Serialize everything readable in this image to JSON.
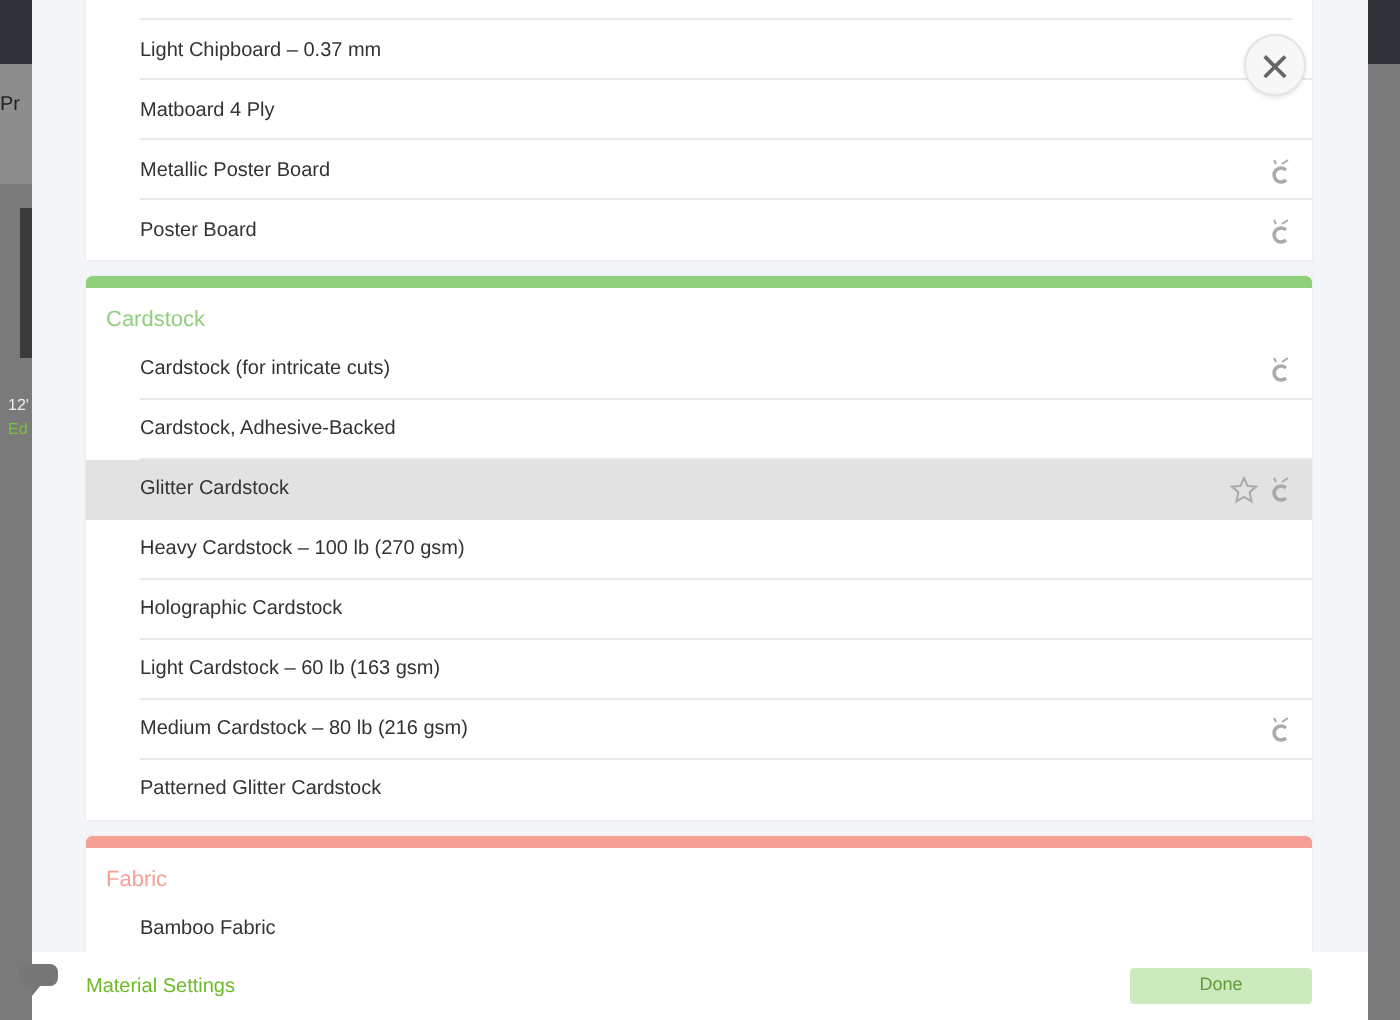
{
  "background": {
    "header_text": "Pr",
    "size_text": "12'",
    "edit_link": "Ed"
  },
  "close_button": {
    "symbol": "×"
  },
  "groups": [
    {
      "cut_top": true,
      "items": [
        {
          "label": "Light Chipboard – 0.37 mm",
          "machine_icon": false,
          "favorite": false,
          "selected": false
        },
        {
          "label": "Matboard 4 Ply",
          "machine_icon": false,
          "favorite": false,
          "selected": false
        },
        {
          "label": "Metallic Poster Board",
          "machine_icon": true,
          "favorite": false,
          "selected": false
        },
        {
          "label": "Poster Board",
          "machine_icon": true,
          "favorite": false,
          "selected": false
        }
      ]
    },
    {
      "title": "Cardstock",
      "color": "#8fd07c",
      "items": [
        {
          "label": "Cardstock (for intricate cuts)",
          "machine_icon": true,
          "favorite": false,
          "selected": false
        },
        {
          "label": "Cardstock, Adhesive-Backed",
          "machine_icon": false,
          "favorite": false,
          "selected": false
        },
        {
          "label": "Glitter Cardstock",
          "machine_icon": true,
          "favorite": true,
          "selected": true
        },
        {
          "label": "Heavy Cardstock – 100 lb (270 gsm)",
          "machine_icon": false,
          "favorite": false,
          "selected": false
        },
        {
          "label": "Holographic Cardstock",
          "machine_icon": false,
          "favorite": false,
          "selected": false
        },
        {
          "label": "Light Cardstock – 60 lb (163 gsm)",
          "machine_icon": false,
          "favorite": false,
          "selected": false
        },
        {
          "label": "Medium Cardstock – 80 lb (216 gsm)",
          "machine_icon": true,
          "favorite": false,
          "selected": false
        },
        {
          "label": "Patterned Glitter Cardstock",
          "machine_icon": false,
          "favorite": false,
          "selected": false
        }
      ]
    },
    {
      "title": "Fabric",
      "color": "#f5a095",
      "items": [
        {
          "label": "Bamboo Fabric",
          "machine_icon": false,
          "favorite": false,
          "selected": false
        }
      ]
    }
  ],
  "footer": {
    "link": "Material Settings",
    "button": {
      "label": "Done",
      "disabled": true
    }
  }
}
